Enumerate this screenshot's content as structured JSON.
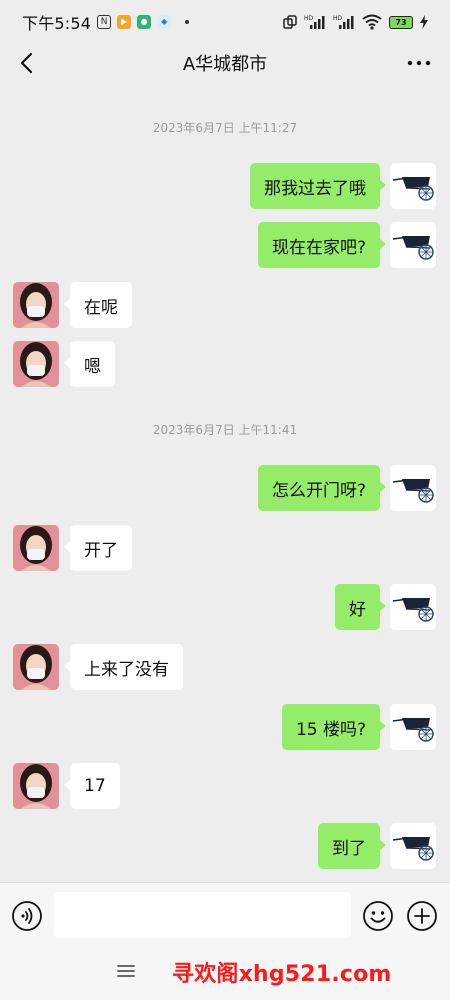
{
  "status_bar": {
    "time": "下午5:54",
    "battery": "73",
    "icons": [
      "nfc-icon",
      "app-notification-icon",
      "app-notification-icon",
      "app-notification-icon",
      "more-notifications-dot",
      "dual-window-icon",
      "signal-hd-icon",
      "signal-hd-icon",
      "wifi-icon",
      "battery-icon",
      "charging-icon"
    ],
    "hd_label": "HD"
  },
  "header": {
    "title": "A华城都市",
    "back_icon": "chevron-left-icon",
    "more_icon": "ellipsis-icon"
  },
  "chat": {
    "timestamps": [
      "2023年6月7日 上午11:27",
      "2023年6月7日 上午11:41"
    ],
    "messages": [
      {
        "from": "me",
        "text": "那我过去了哦"
      },
      {
        "from": "me",
        "text": "现在在家吧?"
      },
      {
        "from": "them",
        "text": "在呢"
      },
      {
        "from": "them",
        "text": "嗯"
      },
      {
        "from": "me",
        "text": "怎么开门呀?"
      },
      {
        "from": "them",
        "text": "开了"
      },
      {
        "from": "me",
        "text": "好"
      },
      {
        "from": "them",
        "text": "上来了没有"
      },
      {
        "from": "me",
        "text": "15 楼吗?"
      },
      {
        "from": "them",
        "text": "17"
      },
      {
        "from": "me",
        "text": "到了"
      }
    ]
  },
  "input_bar": {
    "value": "",
    "placeholder": "",
    "voice_icon": "voice-input-icon",
    "emoji_icon": "emoji-icon",
    "plus_icon": "plus-icon"
  },
  "bottom_nav": {
    "menu_icon": "menu-icon",
    "watermark": "寻欢阁xhg521.com"
  },
  "colors": {
    "background": "#ededed",
    "my_bubble": "#95ec69",
    "their_bubble": "#ffffff",
    "timestamp": "#9b9b9b",
    "watermark": "#ff1a1a"
  }
}
